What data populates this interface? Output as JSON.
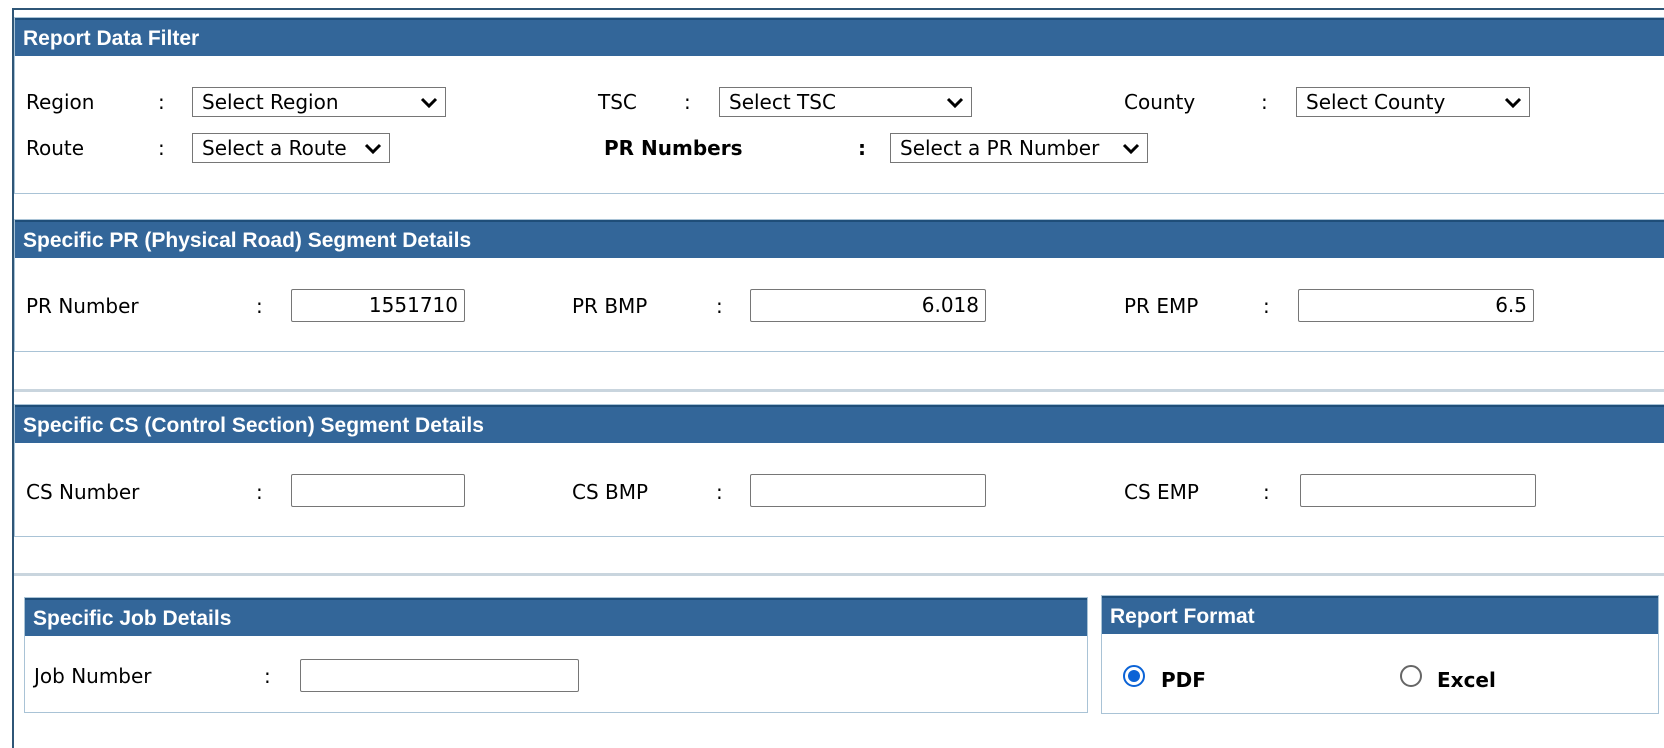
{
  "filter": {
    "title": "Report Data Filter",
    "colon": ":",
    "region_label": "Region",
    "region_value": "Select Region",
    "tsc_label": "TSC",
    "tsc_value": "Select TSC",
    "county_label": "County",
    "county_value": "Select County",
    "route_label": "Route",
    "route_value": "Select a Route",
    "pr_numbers_label": "PR Numbers",
    "pr_numbers_value": "Select a PR Number"
  },
  "pr_segment": {
    "title": "Specific PR (Physical Road) Segment Details",
    "number_label": "PR Number",
    "number_value": "1551710",
    "bmp_label": "PR BMP",
    "bmp_value": "6.018",
    "emp_label": "PR EMP",
    "emp_value": "6.5"
  },
  "cs_segment": {
    "title": "Specific CS (Control Section) Segment Details",
    "number_label": "CS Number",
    "number_value": "",
    "bmp_label": "CS BMP",
    "bmp_value": "",
    "emp_label": "CS EMP",
    "emp_value": ""
  },
  "job": {
    "title": "Specific Job Details",
    "number_label": "Job Number",
    "number_value": ""
  },
  "format": {
    "title": "Report Format",
    "pdf_label": "PDF",
    "excel_label": "Excel",
    "selected": "PDF"
  },
  "icons": {
    "dropdown": "chevron-down-icon"
  }
}
